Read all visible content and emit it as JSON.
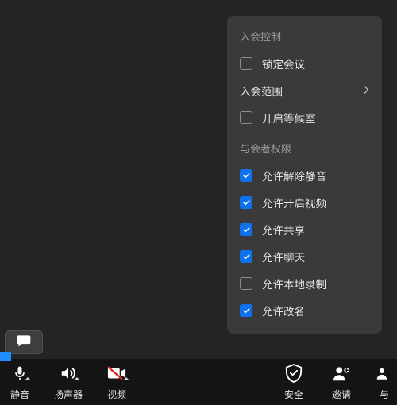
{
  "menu": {
    "section1_title": "入会控制",
    "lock_meeting": "锁定会议",
    "admission_scope": "入会范围",
    "waiting_room": "开启等候室",
    "section2_title": "与会者权限",
    "allow_unmute": "允许解除静音",
    "allow_video": "允许开启视频",
    "allow_share": "允许共享",
    "allow_chat": "允许聊天",
    "allow_local_record": "允许本地录制",
    "allow_rename": "允许改名"
  },
  "toolbar": {
    "mute": "静音",
    "speaker": "扬声器",
    "video": "视频",
    "security": "安全",
    "invite": "邀请",
    "participants_cut": "与"
  }
}
